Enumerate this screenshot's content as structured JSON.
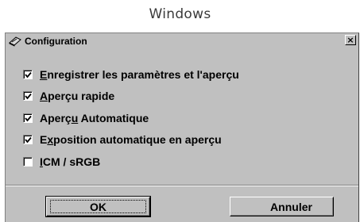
{
  "caption": "Windows",
  "dialog": {
    "title": "Configuration",
    "close_label": "×",
    "icon": "scanner-app-icon"
  },
  "options": [
    {
      "label": "Enregistrer les paramètres et l'aperçu",
      "checked": true,
      "mnemonic": "E"
    },
    {
      "label": "Aperçu rapide",
      "checked": true,
      "mnemonic": "A"
    },
    {
      "label": "Aperçu Automatique",
      "checked": true,
      "mnemonic": "u"
    },
    {
      "label": "Exposition automatique en aperçu",
      "checked": true,
      "mnemonic": "x"
    },
    {
      "label": "ICM / sRGB",
      "checked": false,
      "mnemonic": "I"
    }
  ],
  "buttons": {
    "ok": "OK",
    "cancel": "Annuler"
  }
}
